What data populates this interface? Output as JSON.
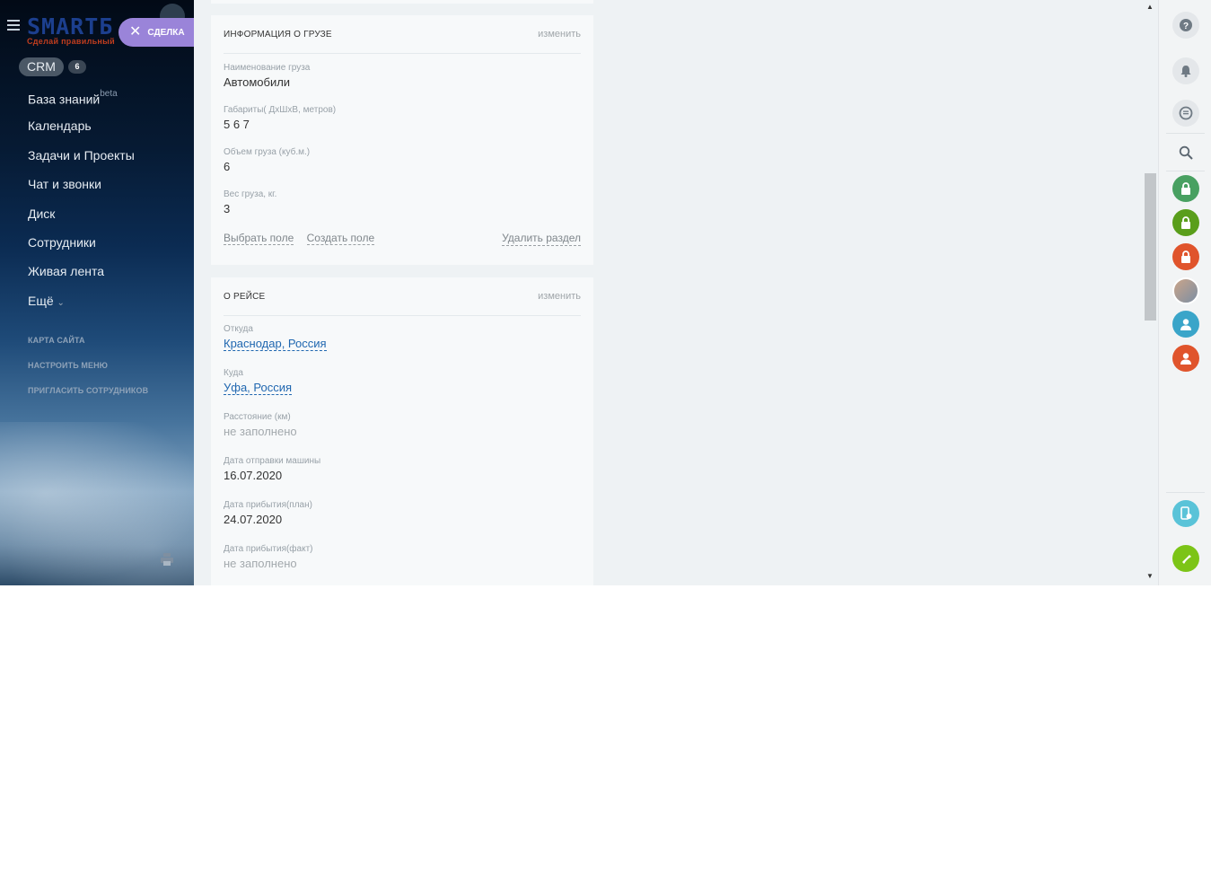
{
  "sidebar": {
    "logo_text": "SMARTБ",
    "logo_tagline": "Сделай правильный",
    "deal_badge": "СДЕЛКА",
    "crm_label": "CRM",
    "crm_count": "6",
    "menu": [
      {
        "label": "База знаний",
        "sup": "beta"
      },
      {
        "label": "Календарь"
      },
      {
        "label": "Задачи и Проекты"
      },
      {
        "label": "Чат и звонки"
      },
      {
        "label": "Диск"
      },
      {
        "label": "Сотрудники"
      },
      {
        "label": "Живая лента"
      },
      {
        "label": "Ещё",
        "arrow": "⌄"
      }
    ],
    "links": [
      "КАРТА САЙТА",
      "НАСТРОИТЬ МЕНЮ",
      "ПРИГЛАСИТЬ СОТРУДНИКОВ"
    ]
  },
  "cargo": {
    "title": "ИНФОРМАЦИЯ О ГРУЗЕ",
    "edit": "изменить",
    "fields": [
      {
        "label": "Наименование груза",
        "value": "Автомобили"
      },
      {
        "label": "Габариты( ДхШхВ, метров)",
        "value": "5 6 7"
      },
      {
        "label": "Объем груза (куб.м.)",
        "value": "6"
      },
      {
        "label": "Вес груза, кг.",
        "value": "3"
      }
    ],
    "actions": {
      "select_field": "Выбрать поле",
      "create_field": "Создать поле",
      "delete_section": "Удалить раздел"
    }
  },
  "trip": {
    "title": "О РЕЙСЕ",
    "edit": "изменить",
    "fields": [
      {
        "label": "Откуда",
        "value": "Краснодар, Россия"
      },
      {
        "label": "Куда",
        "value": "Уфа, Россия"
      },
      {
        "label": "Расстояние (км)",
        "value": "не заполнено"
      },
      {
        "label": "Дата отправки машины",
        "value": "16.07.2020"
      },
      {
        "label": "Дата прибытия(план)",
        "value": "24.07.2020"
      },
      {
        "label": "Дата прибытия(факт)",
        "value": "не заполнено"
      }
    ]
  },
  "rightbar": {
    "icons": [
      "help-icon",
      "bell-icon",
      "chat-icon",
      "search-icon",
      "lock-icon",
      "lock-icon",
      "lock-icon",
      "group-avatar",
      "user-icon",
      "user-icon",
      "mobile-icon",
      "phone-icon"
    ],
    "colors": {
      "green": "#48a061",
      "olive_green": "#5a9e1b",
      "red": "#e0542c",
      "blue": "#3aa5c9",
      "teal": "#5ac3d8",
      "lime": "#7cc417"
    }
  },
  "colors": {
    "deal_badge": "#9a84d9",
    "link": "#2067b0",
    "card_bg": "#f7f9fa",
    "page_bg": "#eef2f4"
  }
}
